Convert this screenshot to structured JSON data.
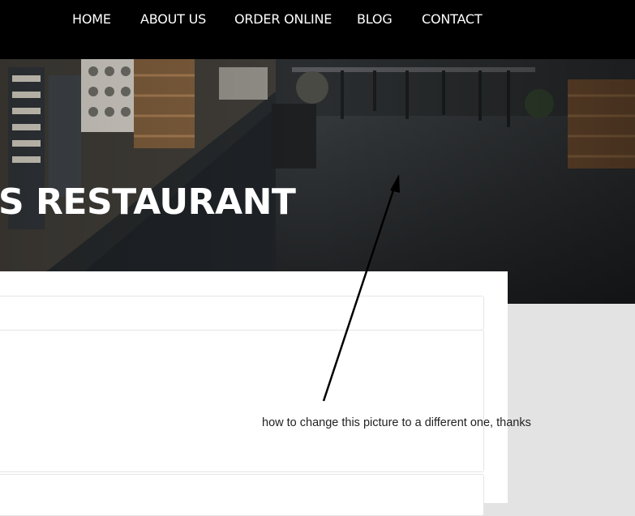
{
  "nav": {
    "items": [
      {
        "label": "HOME"
      },
      {
        "label": "ABOUT US"
      },
      {
        "label": "ORDER ONLINE"
      },
      {
        "label": "BLOG"
      },
      {
        "label": "CONTACT"
      }
    ]
  },
  "hero": {
    "title": "S RESTAURANT"
  },
  "annotation": {
    "text": "how to change this picture to a different one, thanks"
  },
  "colors": {
    "nav_background": "#000000",
    "nav_text": "#ffffff",
    "sidebar_background": "#e3e3e3",
    "hero_title": "#ffffff"
  }
}
